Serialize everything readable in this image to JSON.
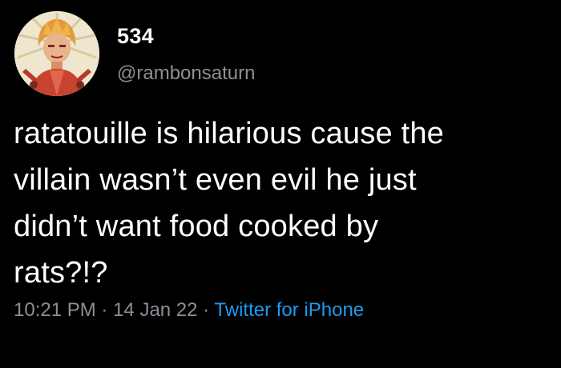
{
  "user": {
    "display_name": "534",
    "handle": "@rambonsaturn",
    "avatar_icon": "user-avatar"
  },
  "tweet": {
    "lines": [
      "ratatouille is hilarious cause the",
      "villain wasn’t even evil he just",
      "didn’t want food cooked by",
      "rats?!?"
    ],
    "time": "10:21 PM",
    "separator": "·",
    "date": "14 Jan 22",
    "source": "Twitter for iPhone"
  },
  "colors": {
    "background": "#000000",
    "text": "#ffffff",
    "secondary": "#8b9096",
    "link": "#1d9bf0"
  }
}
